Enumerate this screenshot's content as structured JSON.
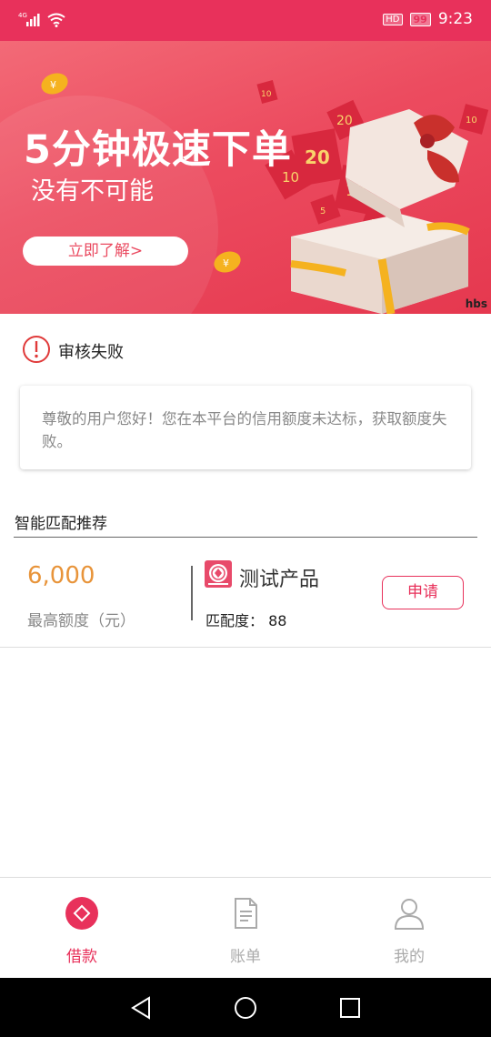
{
  "status_bar": {
    "network": "4G",
    "hd": "HD",
    "battery": "99",
    "time": "9:23"
  },
  "banner": {
    "title": "5分钟极速下单",
    "subtitle": "没有不可能",
    "button_label": "立即了解>",
    "watermark": "hbs",
    "envelope_numbers": [
      "10",
      "20",
      "20",
      "10",
      "10",
      "5",
      "5",
      "10"
    ]
  },
  "audit": {
    "icon": "exclamation-circle-icon",
    "status": "审核失败"
  },
  "notice": {
    "text": "尊敬的用户您好！您在本平台的信用额度未达标，获取额度失败。"
  },
  "recommend": {
    "title": "智能匹配推荐",
    "amount": "6,000",
    "amount_label": "最高额度（元）",
    "product_name": "测试产品",
    "match_label": "匹配度：",
    "match_value": "88",
    "apply_label": "申请"
  },
  "tabs": [
    {
      "label": "借款",
      "icon": "diamond-circle-icon",
      "active": true
    },
    {
      "label": "账单",
      "icon": "document-icon",
      "active": false
    },
    {
      "label": "我的",
      "icon": "user-icon",
      "active": false
    }
  ],
  "colors": {
    "accent": "#e8315b",
    "amount": "#e8943a",
    "inactive": "#aaaaaa"
  }
}
